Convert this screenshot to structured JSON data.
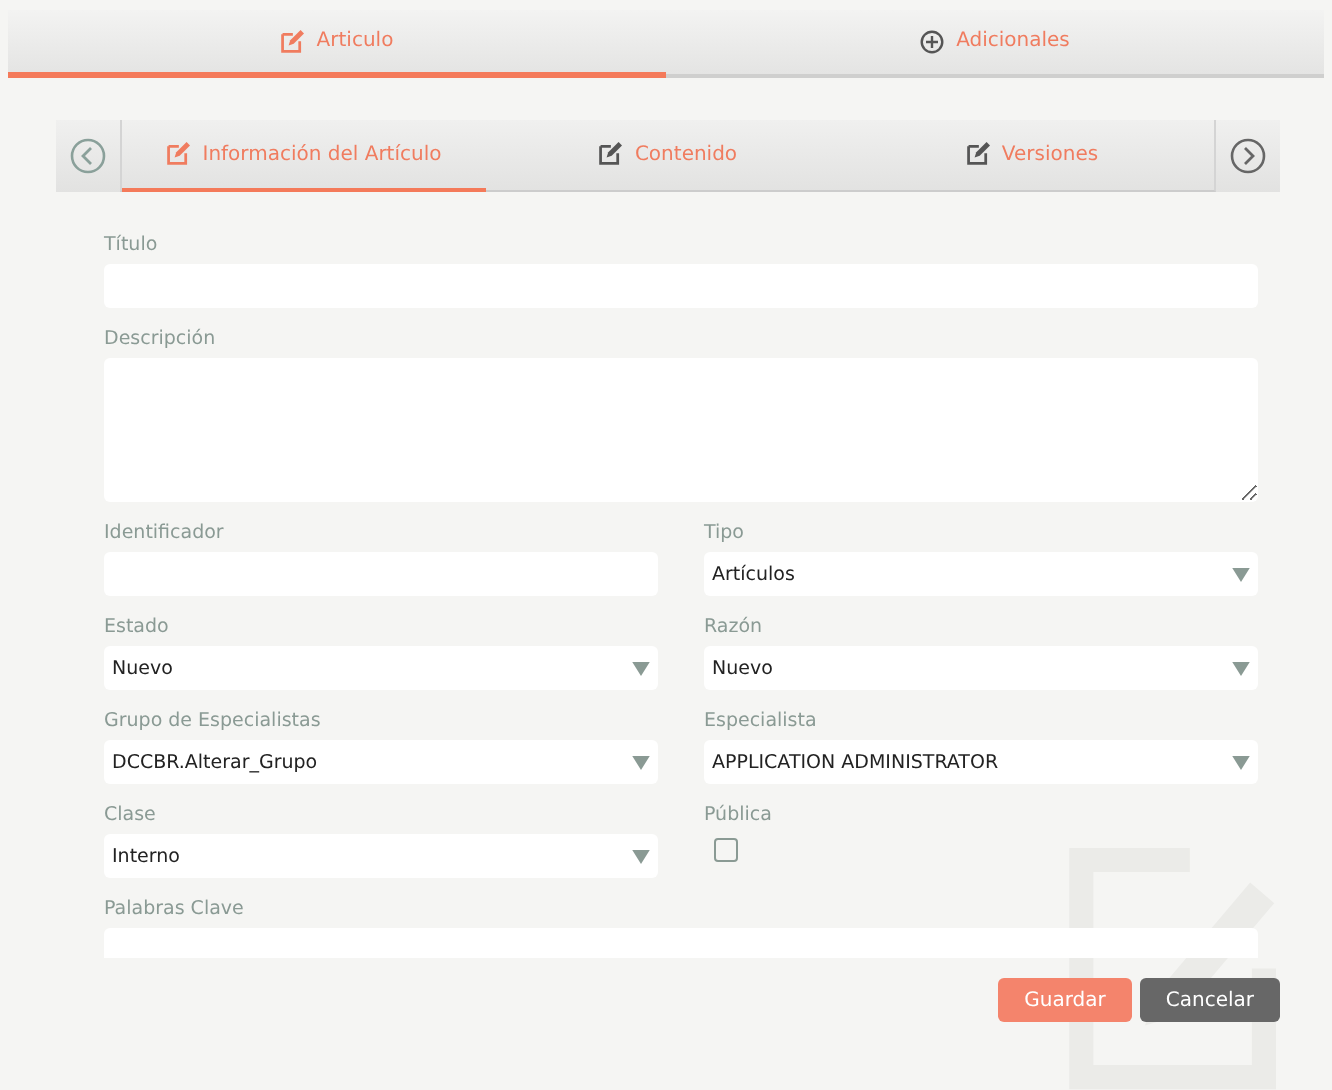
{
  "main_tabs": [
    {
      "label": "Articulo",
      "selected": true
    },
    {
      "label": "Adicionales",
      "selected": false
    }
  ],
  "sub_tabs": [
    {
      "label": "Información del Artículo",
      "selected": true
    },
    {
      "label": "Contenido",
      "selected": false
    },
    {
      "label": "Versiones",
      "selected": false
    }
  ],
  "form_rows": [
    [
      {
        "label": "Título",
        "kind": "text"
      }
    ],
    [
      {
        "label": "Descripción",
        "kind": "textarea"
      }
    ],
    [
      {
        "label": "Identificador",
        "kind": "text"
      },
      {
        "label": "Tipo",
        "kind": "select",
        "value": "Artículos"
      }
    ],
    [
      {
        "label": "Estado",
        "kind": "select",
        "value": "Nuevo"
      },
      {
        "label": "Razón",
        "kind": "select",
        "value": "Nuevo"
      }
    ],
    [
      {
        "label": "Grupo de Especialistas",
        "kind": "select",
        "value": "DCCBR.Alterar_Grupo"
      },
      {
        "label": "Especialista",
        "kind": "select",
        "value": "APPLICATION ADMINISTRATOR"
      }
    ],
    [
      {
        "label": "Clase",
        "kind": "select",
        "value": "Interno"
      },
      {
        "label": "Pública",
        "kind": "checkbox",
        "checked": false
      }
    ],
    [
      {
        "label": "Palabras Clave",
        "kind": "text"
      }
    ]
  ],
  "buttons": [
    {
      "label": "Guardar",
      "kind": "primary"
    },
    {
      "label": "Cancelar",
      "kind": "secondary"
    }
  ]
}
